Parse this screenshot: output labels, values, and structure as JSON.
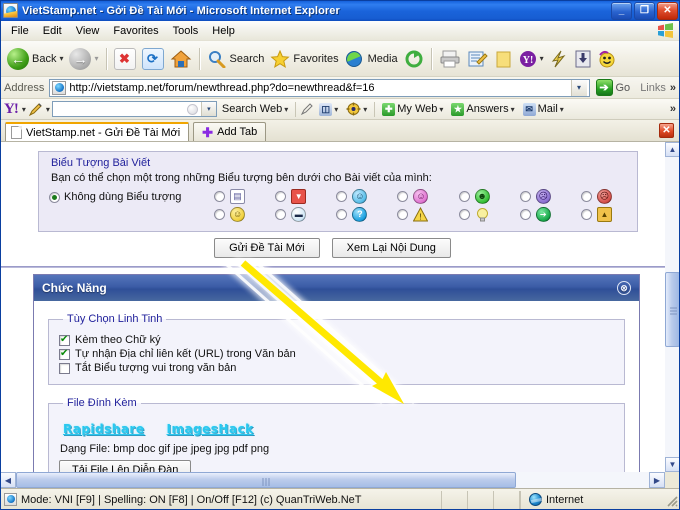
{
  "window": {
    "title": "VietStamp.net - Gởi Đề Tài Mới - Microsoft Internet Explorer",
    "minimize_label": "_",
    "maximize_label": "❐",
    "close_label": "✕"
  },
  "menu": {
    "items": [
      "File",
      "Edit",
      "View",
      "Favorites",
      "Tools",
      "Help"
    ]
  },
  "toolbar": {
    "back_label": "Back",
    "back_caret": "▾",
    "forward_caret": "▾",
    "stop_label": "✖",
    "refresh_label": "⟳",
    "home_label": "⌂",
    "search_label": "Search",
    "favorites_label": "Favorites",
    "media_label": "Media",
    "history_label": "⟳",
    "print_label": "🖶",
    "edit_label": "✎",
    "folder_label": "▭",
    "yahoo_label": "Y!",
    "yahoo_caret": "▾",
    "messenger_label": "⚡",
    "download_label": "▼",
    "smiley_label": "☻"
  },
  "address": {
    "label": "Address",
    "url": "http://vietstamp.net/forum/newthread.php?do=newthread&f=16",
    "dropdown_caret": "▾",
    "go_label": "Go",
    "go_icon": "➔",
    "links_label": "Links",
    "overflow_caret": "»"
  },
  "yahoo_toolbar": {
    "logo": "Y!",
    "logo_caret": "▾",
    "pencil_caret": "▾",
    "search_value": "",
    "search_dropdown": "▾",
    "search_web_label": "Search Web",
    "search_web_caret": "▾",
    "anti_spy_label": "◫",
    "anti_spy_caret": "▾",
    "popup_caret": "▾",
    "my_web_label": "My Web",
    "my_web_caret": "▾",
    "answers_label": "Answers",
    "answers_caret": "▾",
    "mail_label": "Mail",
    "mail_caret": "▾",
    "overflow": "»"
  },
  "tabs": {
    "active_tab_label": "VietStamp.net - Gửi Đề Tài Mới",
    "add_tab_label": "Add Tab",
    "add_tab_plus": "✚",
    "close_label": "✕"
  },
  "page": {
    "post_icons": {
      "legend": "Biểu Tượng Bài Viết",
      "helper_text": "Bạn có thể chọn một trong những Biểu tượng bên dưới cho Bài viết của mình:",
      "no_icon_label": "Không dùng Biểu tượng",
      "no_icon_selected": true,
      "icons": [
        {
          "name": "notepad-icon",
          "glyph": "🗒",
          "color": "#ffffff",
          "text": "▤",
          "fg": "#4a4a8a",
          "shape": "sq"
        },
        {
          "name": "thumbs-down-icon",
          "glyph": "👎",
          "color": "#e8534a",
          "text": "👎",
          "fg": "#ffffff",
          "shape": "sq"
        },
        {
          "name": "cool-smile-icon",
          "glyph": "😎",
          "color": "#6ec8f0",
          "text": "☺",
          "fg": "#0b4a6e",
          "shape": "rd"
        },
        {
          "name": "pink-smile-icon",
          "glyph": "😊",
          "color": "#e07ad0",
          "text": "☺",
          "fg": "#6b1060",
          "shape": "rd"
        },
        {
          "name": "green-grin-icon",
          "glyph": "😀",
          "color": "#3fbf3f",
          "text": "☻",
          "fg": "#0a4a0a",
          "shape": "rd"
        },
        {
          "name": "purple-sad-icon",
          "glyph": "😟",
          "color": "#8d6fd0",
          "text": "☹",
          "fg": "#2b1060",
          "shape": "rd"
        },
        {
          "name": "red-angry-icon",
          "glyph": "😠",
          "color": "#d4504a",
          "text": "☹",
          "fg": "#5a0d09",
          "shape": "rd"
        },
        {
          "name": "yellow-smile-icon",
          "glyph": "🙂",
          "color": "#f2d44a",
          "text": "☺",
          "fg": "#6a5400",
          "shape": "rd"
        },
        {
          "name": "sunglasses-icon",
          "glyph": "😎",
          "color": "#cfe6f5",
          "text": "▬",
          "fg": "#1a2a4a",
          "shape": "rd"
        },
        {
          "name": "question-icon",
          "glyph": "❓",
          "color": "#2aa8e0",
          "text": "?",
          "fg": "#ffffff",
          "shape": "rd"
        },
        {
          "name": "warning-icon",
          "glyph": "⚠",
          "color": "#f5d547",
          "text": "!",
          "fg": "#4a3a00",
          "shape": "tri"
        },
        {
          "name": "lightbulb-icon",
          "glyph": "💡",
          "color": "#f6ec8a",
          "text": "",
          "fg": "#7a6a00",
          "shape": "bulb"
        },
        {
          "name": "arrow-right-icon",
          "glyph": "➡",
          "color": "#17a84a",
          "text": "➔",
          "fg": "#ffffff",
          "shape": "rd"
        },
        {
          "name": "thumbs-up-icon",
          "glyph": "👍",
          "color": "#f0c24a",
          "text": "👍",
          "fg": "#6a4a00",
          "shape": "sq"
        }
      ]
    },
    "buttons": {
      "submit_label": "Gửi Đề Tài Mới",
      "preview_label": "Xem Lại Nội Dung"
    },
    "functions_panel": {
      "title": "Chức Năng",
      "collapse_icon": "⊗",
      "misc_options": {
        "legend": "Tùy Chọn Linh Tinh",
        "items": [
          {
            "label": "Kèm theo Chữ ký",
            "checked": true
          },
          {
            "label": "Tự nhận Địa chỉ liên kết (URL) trong Văn bản",
            "checked": true
          },
          {
            "label": "Tắt Biểu tượng vui trong văn bản",
            "checked": false
          }
        ]
      },
      "attachments": {
        "legend": "File Đính Kèm",
        "host_links": [
          "Rapidshare",
          "ImagesHack"
        ],
        "file_types_label": "Dạng File: bmp doc gif jpe jpeg jpg pdf png",
        "upload_button_label": "Tải File Lên Diễn Đàn"
      }
    }
  },
  "scroll": {
    "up_arrow": "▲",
    "down_arrow": "▼",
    "left_arrow": "◀",
    "right_arrow": "▶"
  },
  "statusbar": {
    "message": "Mode: VNI [F9] | Spelling: ON [F8] | On/Off [F12] (c) QuanTriWeb.NeT",
    "zone_label": "Internet"
  },
  "annotation": {
    "arrow_color": "#ffe800",
    "arrow_glow": "#ffffff"
  }
}
